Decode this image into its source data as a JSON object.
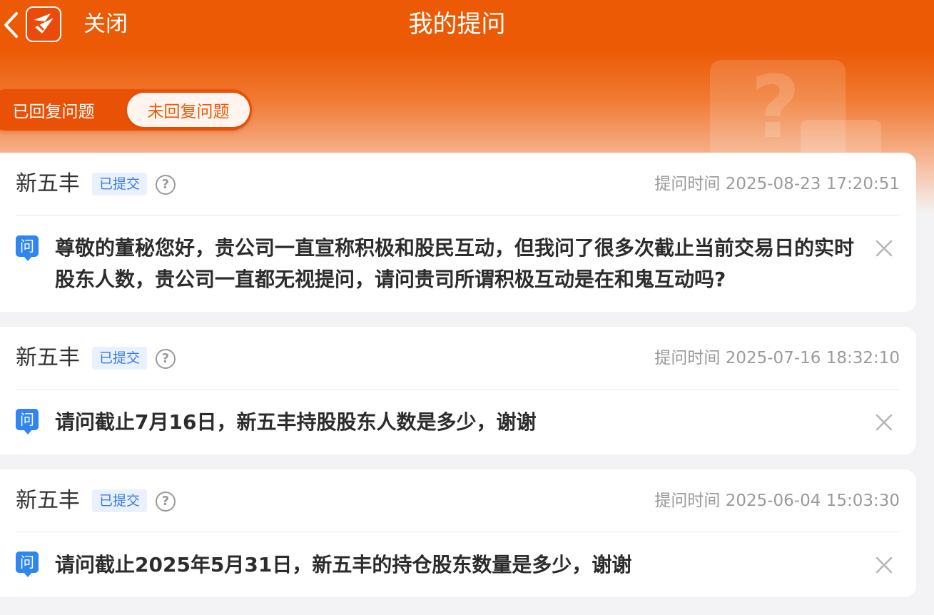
{
  "header": {
    "close_label": "关闭",
    "title": "我的提问"
  },
  "tabs": {
    "replied": "已回复问题",
    "unreplied": "未回复问题",
    "active": "unreplied"
  },
  "questions": [
    {
      "company": "新五丰",
      "status": "已提交",
      "time": "提问时间 2025-08-23 17:20:51",
      "q_badge": "问",
      "text": "尊敬的董秘您好，贵公司一直宣称积极和股民互动，但我问了很多次截止当前交易日的实时股东人数，贵公司一直都无视提问，请问贵司所谓积极互动是在和鬼互动吗?"
    },
    {
      "company": "新五丰",
      "status": "已提交",
      "time": "提问时间 2025-07-16 18:32:10",
      "q_badge": "问",
      "text": "请问截止7月16日，新五丰持股股东人数是多少，谢谢"
    },
    {
      "company": "新五丰",
      "status": "已提交",
      "time": "提问时间 2025-06-04 15:03:30",
      "q_badge": "问",
      "text": "请问截止2025年5月31日，新五丰的持仓股东数量是多少，谢谢"
    }
  ],
  "colors": {
    "brand": "#ec5a05",
    "badge_bg": "#e8f1fd",
    "badge_text": "#3a7be0",
    "question_icon": "#2f86f0"
  }
}
